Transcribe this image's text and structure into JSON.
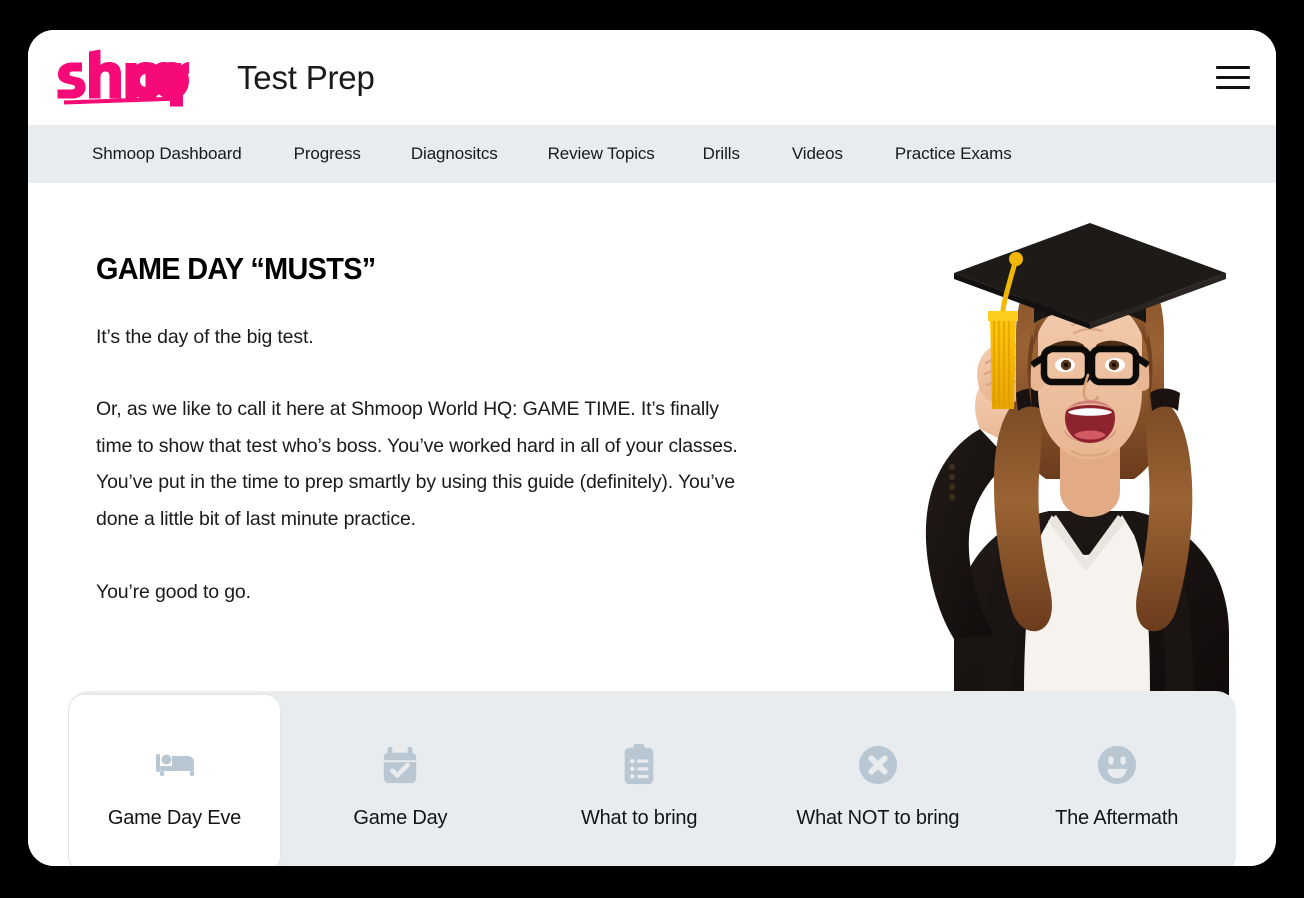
{
  "window": {
    "background_color": "#000000",
    "card_background": "#ffffff"
  },
  "header": {
    "logo_text": "shmoop",
    "logo_color": "#f50a78",
    "title": "Test Prep",
    "menu_icon": "hamburger-menu-icon"
  },
  "subnav": {
    "background_color": "#e8ecef",
    "items": [
      {
        "label": "Shmoop Dashboard"
      },
      {
        "label": "Progress"
      },
      {
        "label": "Diagnositcs"
      },
      {
        "label": "Review Topics"
      },
      {
        "label": "Drills"
      },
      {
        "label": "Videos"
      },
      {
        "label": "Practice Exams"
      }
    ]
  },
  "main": {
    "heading": "GAME DAY “MUSTS”",
    "paragraphs": [
      "It’s the day of the big test.",
      "Or, as we like to call it here at Shmoop World HQ: GAME TIME. It’s finally time to show that test who’s boss. You’ve worked hard in all of your classes. You’ve put in the time to prep smartly by using this guide (definitely). You’ve done a little bit of last minute practice.",
      "You’re good to go."
    ],
    "hero_image": {
      "alt": "graduate-student-cheering-photo",
      "description": "Young woman wearing a black graduation cap with a yellow tassel, black-rimmed glasses, pigtails, black blazer and white top, raising a fist and shouting"
    }
  },
  "tabbar": {
    "background_color": "#e8ecef",
    "icon_color": "#b9c7d2",
    "active_index": 0,
    "tabs": [
      {
        "label": "Game Day Eve",
        "icon": "bed-icon",
        "active": true
      },
      {
        "label": "Game Day",
        "icon": "calendar-check-icon",
        "active": false
      },
      {
        "label": "What to bring",
        "icon": "clipboard-list-icon",
        "active": false
      },
      {
        "label": "What NOT to bring",
        "icon": "x-circle-icon",
        "active": false
      },
      {
        "label": "The Aftermath",
        "icon": "smiley-face-icon",
        "active": false
      }
    ]
  }
}
